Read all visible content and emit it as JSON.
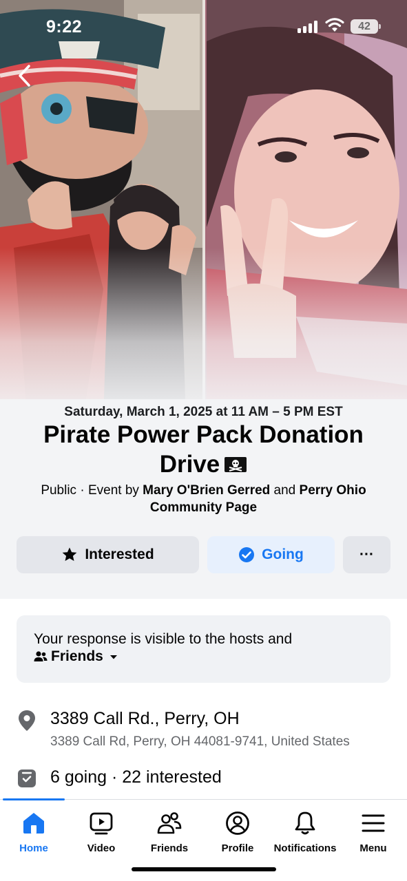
{
  "status_bar": {
    "time": "9:22",
    "battery": "42"
  },
  "event": {
    "date": "Saturday, March 1, 2025 at 11 AM – 5 PM EST",
    "title": "Pirate Power Pack Donation Drive",
    "visibility": "Public",
    "event_by_prefix": "· Event by",
    "host_1": "Mary O'Brien Gerred",
    "conjunction": "and",
    "host_2": "Perry Ohio Community Page"
  },
  "actions": {
    "interested_label": "Interested",
    "going_label": "Going",
    "more_label": "···"
  },
  "response_notice": {
    "text": "Your response is visible to the hosts and",
    "audience": "Friends"
  },
  "location": {
    "name": "3389 Call Rd., Perry, OH",
    "address": "3389 Call Rd, Perry, OH 44081-9741, United States"
  },
  "attendance": {
    "text": "6 going · 22 interested"
  },
  "tabs": [
    {
      "label": "Home",
      "icon": "home-icon",
      "active": true
    },
    {
      "label": "Video",
      "icon": "video-icon"
    },
    {
      "label": "Friends",
      "icon": "friends-icon"
    },
    {
      "label": "Profile",
      "icon": "profile-icon"
    },
    {
      "label": "Notifications",
      "icon": "bell-icon"
    },
    {
      "label": "Menu",
      "icon": "menu-icon"
    }
  ],
  "colors": {
    "accent": "#1877f2",
    "going_bg": "#e7f0fd",
    "button_gray": "#e4e6eb",
    "secondary_text": "#65676b"
  }
}
